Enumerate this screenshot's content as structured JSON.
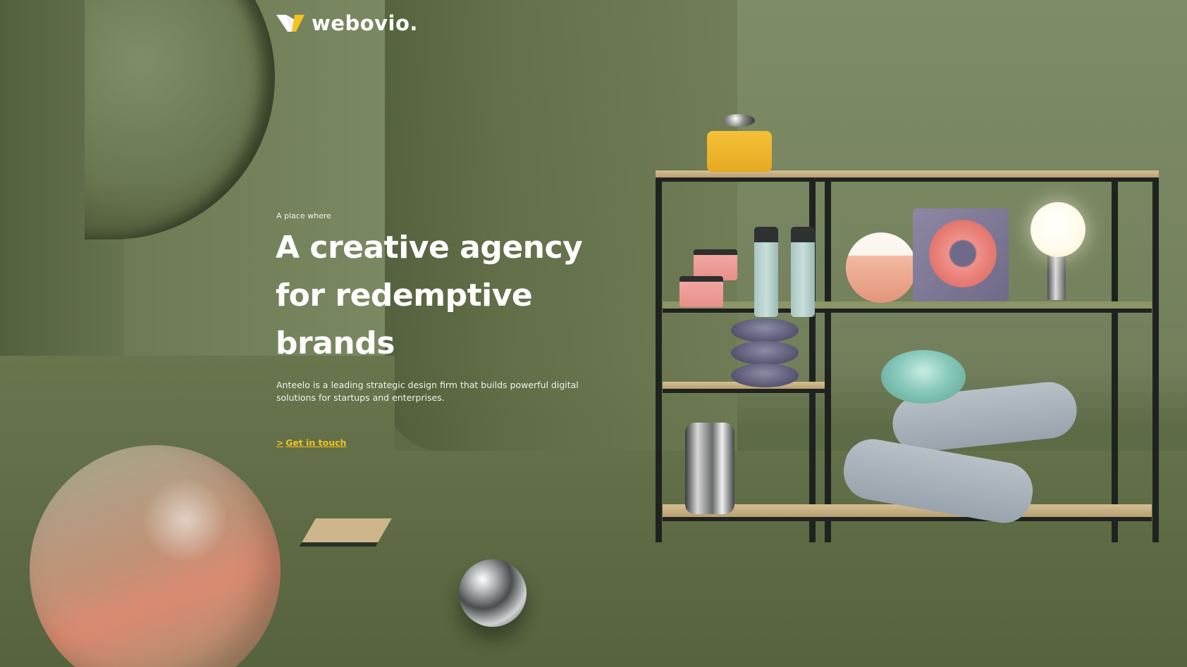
{
  "brand": {
    "name": "webovio.",
    "logo_icon": "webovio-logo-icon",
    "accent_color": "#F3C21E"
  },
  "hero": {
    "eyebrow": "A place where",
    "headline_lines": [
      "A creative agency",
      "for redemptive",
      "brands"
    ],
    "description_lines": [
      "Anteelo is a leading strategic design firm that builds powerful digital",
      "solutions for startups and enterprises."
    ],
    "cta_label": "Get in touch",
    "cta_icon": "chevron-right-icon"
  }
}
